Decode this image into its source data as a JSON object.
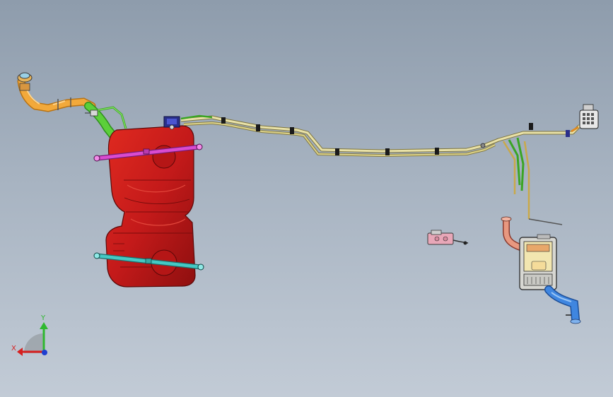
{
  "viewport": {
    "background_top": "#8e9cac",
    "background_bottom": "#c2cbd6"
  },
  "parts": [
    {
      "name": "fuel-filler-neck",
      "color": "#f2a93b"
    },
    {
      "name": "filler-hose",
      "color": "#5ccf3a"
    },
    {
      "name": "fuel-tank",
      "color": "#c41a1a"
    },
    {
      "name": "tank-strap-upper",
      "color": "#d94bd0"
    },
    {
      "name": "tank-strap-lower",
      "color": "#44c9c4"
    },
    {
      "name": "fuel-pump-connector",
      "color": "#2a2f8a"
    },
    {
      "name": "fuel-lines",
      "color": "#d9cf86"
    },
    {
      "name": "canister-connector",
      "color": "#e8e8e8"
    },
    {
      "name": "small-valve-assembly",
      "color": "#e8a7b8"
    },
    {
      "name": "evap-canister",
      "color": "#f2e6b0"
    },
    {
      "name": "canister-inlet-hose",
      "color": "#e89880"
    },
    {
      "name": "canister-outlet-hose",
      "color": "#3f86e0"
    }
  ],
  "triad": {
    "x_label": "X",
    "y_label": "Y",
    "x_color": "#d62020",
    "y_color": "#2fb82f",
    "z_color": "#1f3fd0"
  }
}
